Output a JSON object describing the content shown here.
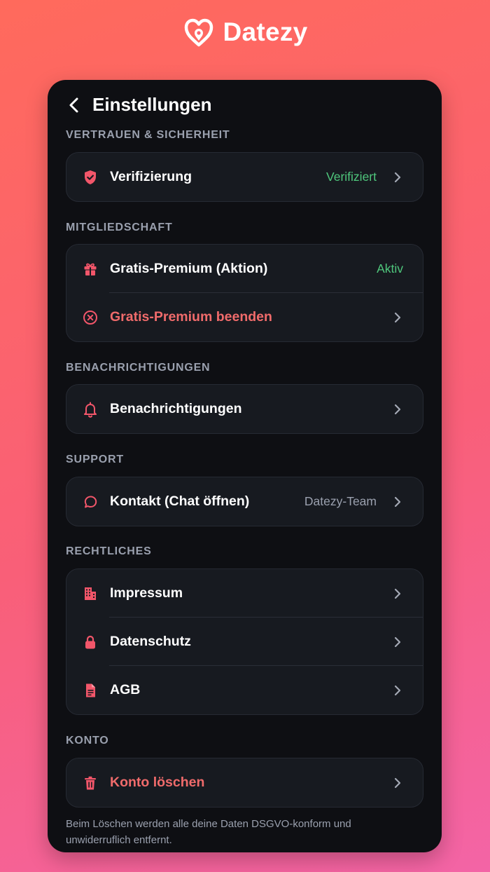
{
  "brand": {
    "name": "Datezy"
  },
  "header": {
    "title": "Einstellungen"
  },
  "sections": [
    {
      "title": "VERTRAUEN & SICHERHEIT",
      "items": [
        {
          "label": "Verifizierung",
          "value": "Verifiziert",
          "icon": "shield-check-icon"
        }
      ]
    },
    {
      "title": "MITGLIEDSCHAFT",
      "items": [
        {
          "label": "Gratis-Premium (Aktion)",
          "value": "Aktiv",
          "icon": "gift-icon"
        },
        {
          "label": "Gratis-Premium beenden",
          "icon": "circle-x-icon"
        }
      ]
    },
    {
      "title": "BENACHRICHTIGUNGEN",
      "items": [
        {
          "label": "Benachrichtigungen",
          "icon": "bell-icon"
        }
      ]
    },
    {
      "title": "SUPPORT",
      "items": [
        {
          "label": "Kontakt (Chat öffnen)",
          "value": "Datezy-Team",
          "icon": "chat-bubble-icon"
        }
      ]
    },
    {
      "title": "RECHTLICHES",
      "items": [
        {
          "label": "Impressum",
          "icon": "building-icon"
        },
        {
          "label": "Datenschutz",
          "icon": "lock-icon"
        },
        {
          "label": "AGB",
          "icon": "document-icon"
        }
      ]
    },
    {
      "title": "KONTO",
      "items": [
        {
          "label": "Konto löschen",
          "icon": "trash-icon"
        }
      ]
    }
  ],
  "footnote": "Beim Löschen werden alle deine Daten DSGVO-konform und unwiderruflich entfernt.",
  "colors": {
    "accent": "#f2566a",
    "danger_text": "#f06b6b",
    "success": "#4fc77c",
    "background": "#0e0f13",
    "card": "#171a20"
  }
}
